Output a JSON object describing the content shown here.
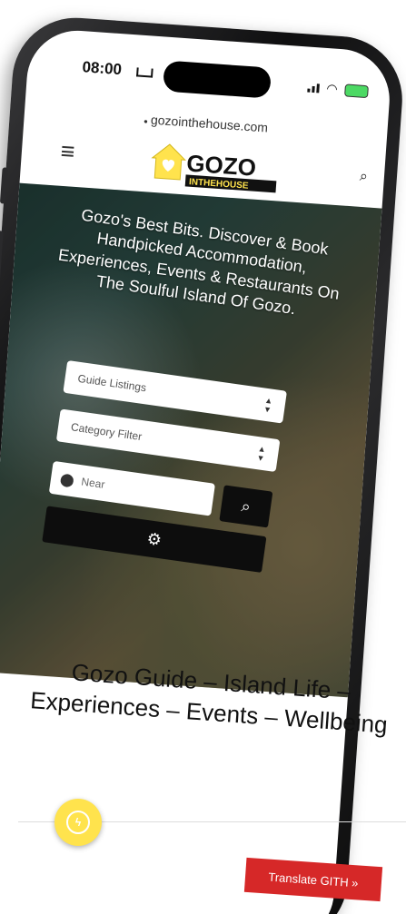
{
  "status_bar": {
    "time": "08:00"
  },
  "browser": {
    "url": "gozointhehouse.com"
  },
  "header": {
    "logo_line1": "GOZO",
    "logo_line2": "INTHEHOUSE"
  },
  "hero": {
    "title": "Gozo's Best Bits. Discover & Book Handpicked Accommodation, Experiences, Events & Restaurants On The Soulful Island Of Gozo.",
    "guide_select": "Guide Listings",
    "category_select": "Category Filter",
    "near_placeholder": "Near"
  },
  "section": {
    "title": "Gozo Guide – Island Life – Experiences – Events – Wellbeing"
  },
  "footer": {
    "translate_label": "Translate GITH »"
  },
  "colors": {
    "accent_yellow": "#ffe34d",
    "translate_red": "#d62828",
    "button_black": "#0d0d0d"
  }
}
